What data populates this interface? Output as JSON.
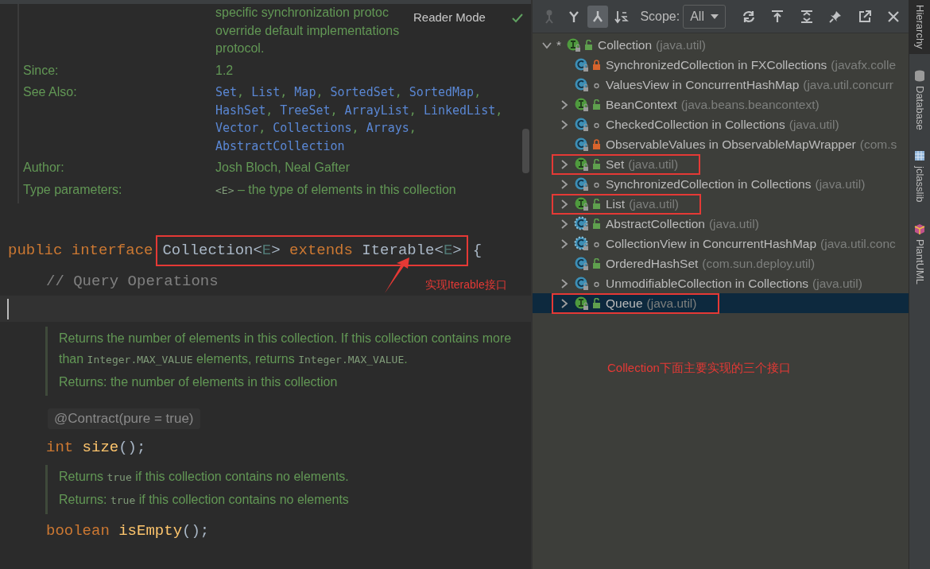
{
  "editor": {
    "description_lines": [
      "specific synchronization protoc",
      "override default implementations",
      "protocol."
    ],
    "reader_mode": {
      "label": "Reader Mode"
    },
    "fields": [
      {
        "label": "Since:",
        "lines": [
          [
            {
              "kind": "text",
              "text": "1.2"
            }
          ]
        ]
      },
      {
        "label": "See Also:",
        "lines": [
          [
            {
              "kind": "link",
              "text": "Set"
            },
            {
              "kind": "text",
              "text": ", "
            },
            {
              "kind": "link",
              "text": "List"
            },
            {
              "kind": "text",
              "text": ", "
            },
            {
              "kind": "link",
              "text": "Map"
            },
            {
              "kind": "text",
              "text": ", "
            },
            {
              "kind": "link",
              "text": "SortedSet"
            },
            {
              "kind": "text",
              "text": ", "
            },
            {
              "kind": "link",
              "text": "SortedMap"
            },
            {
              "kind": "text",
              "text": ","
            }
          ],
          [
            {
              "kind": "link",
              "text": "HashSet"
            },
            {
              "kind": "text",
              "text": ", "
            },
            {
              "kind": "link",
              "text": "TreeSet"
            },
            {
              "kind": "text",
              "text": ", "
            },
            {
              "kind": "link",
              "text": "ArrayList"
            },
            {
              "kind": "text",
              "text": ", "
            },
            {
              "kind": "link",
              "text": "LinkedList"
            },
            {
              "kind": "text",
              "text": ","
            }
          ],
          [
            {
              "kind": "link",
              "text": "Vector"
            },
            {
              "kind": "text",
              "text": ", "
            },
            {
              "kind": "link",
              "text": "Collections"
            },
            {
              "kind": "text",
              "text": ", "
            },
            {
              "kind": "link",
              "text": "Arrays"
            },
            {
              "kind": "text",
              "text": ","
            }
          ],
          [
            {
              "kind": "link",
              "text": "AbstractCollection"
            }
          ]
        ]
      },
      {
        "label": "Author:",
        "lines": [
          [
            {
              "kind": "text",
              "text": "Josh Bloch, Neal Gafter"
            }
          ]
        ]
      },
      {
        "label": "Type parameters:",
        "lines": [
          [
            {
              "kind": "code",
              "text": "<E>"
            },
            {
              "kind": "text",
              "text": " – the type of elements in this collection"
            }
          ]
        ]
      }
    ],
    "blocks": [
      {
        "kind": "declaration",
        "before": [
          {
            "kind": "keyword",
            "text": "public interface"
          }
        ],
        "framed": [
          {
            "kind": "plain",
            "text": "Collection<"
          },
          {
            "kind": "typeparam",
            "text": "E"
          },
          {
            "kind": "plain",
            "text": "> "
          },
          {
            "kind": "keyword",
            "text": "extends "
          },
          {
            "kind": "plain",
            "text": "Iterable<"
          },
          {
            "kind": "typeparam",
            "text": "E"
          },
          {
            "kind": "plain",
            "text": ">"
          }
        ],
        "after": [
          {
            "kind": "plain",
            "text": "{"
          }
        ]
      },
      {
        "kind": "statement",
        "before": [
          {
            "kind": "comment",
            "text": "// Query Operations"
          }
        ]
      },
      {
        "kind": "caret-line"
      },
      {
        "kind": "doc",
        "paragraphs": [
          [
            {
              "kind": "text",
              "text": "Returns the number of elements in this collection. If this collection contains more than "
            },
            {
              "kind": "code",
              "text": "Integer.MAX_VALUE"
            },
            {
              "kind": "text",
              "text": " elements, returns "
            },
            {
              "kind": "code",
              "text": "Integer.MAX_VALUE"
            },
            {
              "kind": "text",
              "text": "."
            }
          ]
        ],
        "returns": {
          "label": "Returns:",
          "segments": [
            {
              "kind": "text",
              "text": "the number of elements in this collection"
            }
          ]
        }
      },
      {
        "kind": "inlay",
        "text": "@Contract(pure = true)"
      },
      {
        "kind": "statement",
        "before": [
          {
            "kind": "keyword",
            "text": "int "
          },
          {
            "kind": "method",
            "text": "size"
          },
          {
            "kind": "plain",
            "text": "();"
          }
        ]
      },
      {
        "kind": "doc",
        "paragraphs": [
          [
            {
              "kind": "text",
              "text": "Returns "
            },
            {
              "kind": "code",
              "text": "true"
            },
            {
              "kind": "text",
              "text": " if this collection contains no elements."
            }
          ]
        ],
        "returns": {
          "label": "Returns:",
          "segments": [
            {
              "kind": "code",
              "text": "true"
            },
            {
              "kind": "text",
              "text": " if this collection contains no elements"
            }
          ]
        }
      },
      {
        "kind": "statement",
        "before": [
          {
            "kind": "keyword",
            "text": "boolean "
          },
          {
            "kind": "method",
            "text": "isEmpty"
          },
          {
            "kind": "plain",
            "text": "();"
          }
        ]
      }
    ],
    "callout": {
      "text": "实现Iterable接口"
    }
  },
  "hierarchy": {
    "toolbar_left": [
      {
        "kind": "supertypes",
        "selected": false,
        "disabled": true
      },
      {
        "kind": "type-hierarchy",
        "selected": false,
        "disabled": false
      },
      {
        "kind": "subtypes",
        "selected": true,
        "disabled": false
      },
      {
        "kind": "sort",
        "selected": false,
        "disabled": false
      }
    ],
    "scope": {
      "label": "Scope:",
      "value": "All"
    },
    "toolbar_right": [
      {
        "kind": "refresh"
      },
      {
        "kind": "export"
      },
      {
        "kind": "expand"
      },
      {
        "kind": "pin"
      },
      {
        "kind": "open-window"
      },
      {
        "kind": "close"
      }
    ],
    "tree": {
      "kind": "interface",
      "prefix": "*",
      "name": "Collection",
      "package": "(java.util)",
      "public": true,
      "private": false,
      "expanded": true,
      "selected": false,
      "highlighted": false,
      "children": [
        {
          "kind": "class",
          "name": "SynchronizedCollection in FXCollections",
          "package": "(javafx.colle",
          "public": false,
          "private": true,
          "selected": false,
          "highlighted": false
        },
        {
          "kind": "class",
          "name": "ValuesView in ConcurrentHashMap",
          "package": "(java.util.concurr",
          "public": false,
          "private": false,
          "selected": false,
          "highlighted": false
        },
        {
          "kind": "interface",
          "name": "BeanContext",
          "package": "(java.beans.beancontext)",
          "public": true,
          "private": false,
          "expanded": false,
          "selected": false,
          "highlighted": false
        },
        {
          "kind": "class",
          "name": "CheckedCollection in Collections",
          "package": "(java.util)",
          "public": false,
          "private": false,
          "expanded": false,
          "selected": false,
          "highlighted": false
        },
        {
          "kind": "class",
          "name": "ObservableValues in ObservableMapWrapper",
          "package": "(com.s",
          "public": false,
          "private": true,
          "selected": false,
          "highlighted": false
        },
        {
          "kind": "interface",
          "name": "Set",
          "package": "(java.util)",
          "public": true,
          "private": false,
          "expanded": false,
          "selected": false,
          "highlighted": true
        },
        {
          "kind": "class",
          "name": "SynchronizedCollection in Collections",
          "package": "(java.util)",
          "public": false,
          "private": false,
          "expanded": false,
          "selected": false,
          "highlighted": false
        },
        {
          "kind": "interface",
          "name": "List",
          "package": "(java.util)",
          "public": true,
          "private": false,
          "expanded": false,
          "selected": false,
          "highlighted": true
        },
        {
          "kind": "abstract-class",
          "name": "AbstractCollection",
          "package": "(java.util)",
          "public": true,
          "private": false,
          "expanded": false,
          "selected": false,
          "highlighted": false
        },
        {
          "kind": "abstract-class",
          "name": "CollectionView in ConcurrentHashMap",
          "package": "(java.util.conc",
          "public": false,
          "private": false,
          "expanded": false,
          "selected": false,
          "highlighted": false
        },
        {
          "kind": "class",
          "name": "OrderedHashSet",
          "package": "(com.sun.deploy.util)",
          "public": true,
          "private": false,
          "selected": false,
          "highlighted": false
        },
        {
          "kind": "class",
          "name": "UnmodifiableCollection in Collections",
          "package": "(java.util)",
          "public": false,
          "private": false,
          "expanded": false,
          "selected": false,
          "highlighted": false
        },
        {
          "kind": "interface",
          "name": "Queue",
          "package": "(java.util)",
          "public": true,
          "private": false,
          "expanded": false,
          "selected": true,
          "highlighted": true
        }
      ]
    },
    "callout": {
      "text": "Collection下面主要实现的三个接口"
    }
  },
  "tool_windows": [
    {
      "kind": "hierarchy",
      "label": "Hierarchy",
      "selected": true
    },
    {
      "kind": "database",
      "label": "Database",
      "selected": false
    },
    {
      "kind": "jclasslib",
      "label": "jclasslib",
      "selected": false
    },
    {
      "kind": "plantuml",
      "label": "PlantUML",
      "selected": false
    }
  ]
}
